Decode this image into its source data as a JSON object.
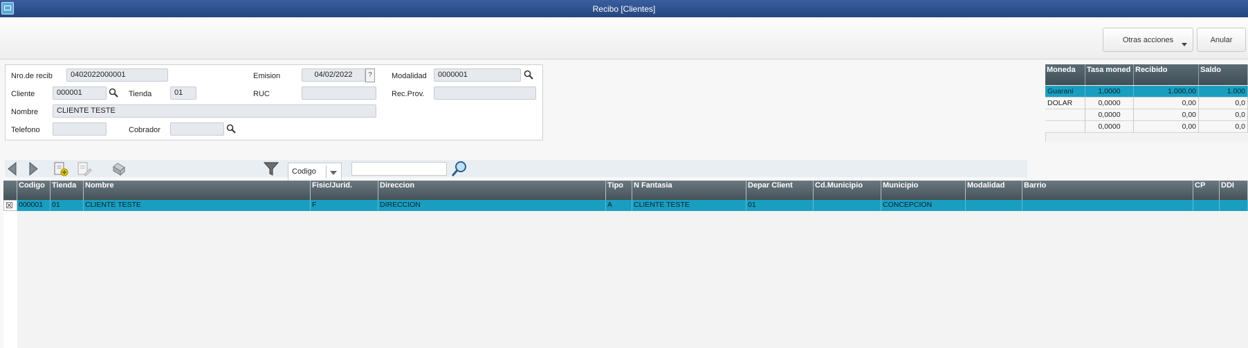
{
  "window": {
    "title": "Recibo [Clientes]"
  },
  "toolbar": {
    "other_actions_label": "Otras acciones",
    "cancel_label": "Anular"
  },
  "form": {
    "receipt_number": {
      "label": "Nro.de recib",
      "value": "0402022000001"
    },
    "issue_date": {
      "label": "Emision",
      "value": "04/02/2022",
      "help": "?"
    },
    "modality": {
      "label": "Modalidad",
      "value": "0000001"
    },
    "customer": {
      "label": "Cliente",
      "value": "000001"
    },
    "store": {
      "label": "Tienda",
      "value": "01"
    },
    "ruc": {
      "label": "RUC",
      "value": ""
    },
    "supplier_receipt": {
      "label": "Rec.Prov.",
      "value": ""
    },
    "name": {
      "label": "Nombre",
      "value": "CLIENTE TESTE"
    },
    "phone": {
      "label": "Telefono",
      "value": ""
    },
    "collector": {
      "label": "Cobrador",
      "value": ""
    }
  },
  "currency_grid": {
    "headers": [
      "Moneda",
      "Tasa moned",
      "Recibido",
      "Saldo"
    ],
    "rows": [
      [
        "Guarani",
        "1,0000",
        "1.000,00",
        "1.000"
      ],
      [
        "DOLAR",
        "0,0000",
        "0,00",
        "0,0"
      ],
      [
        "",
        "0,0000",
        "0,00",
        "0,0"
      ],
      [
        "",
        "0,0000",
        "0,00",
        "0,0"
      ]
    ]
  },
  "navigation": {
    "search_field_option": "Codigo",
    "search_value": ""
  },
  "customer_grid": {
    "headers": [
      "Codigo",
      "Tienda",
      "Nombre",
      "Fisic/Jurid.",
      "Direccion",
      "Tipo",
      "N Fantasia",
      "Depar Client",
      "Cd.Municipio",
      "Municipio",
      "Modalidad",
      "Barrio",
      "CP",
      "DDI"
    ],
    "rows": [
      [
        "000001",
        "01",
        "CLIENTE TESTE",
        "F",
        "DIRECCION",
        "A",
        "CLIENTE TESTE",
        "01",
        "",
        "CONCEPCION",
        "",
        "",
        "",
        ""
      ]
    ],
    "selection_mark": "☒"
  },
  "colors": {
    "title_bar": "#2f528e",
    "selected_row": "#1a9ec0",
    "grid_header": "#4f5d66"
  }
}
